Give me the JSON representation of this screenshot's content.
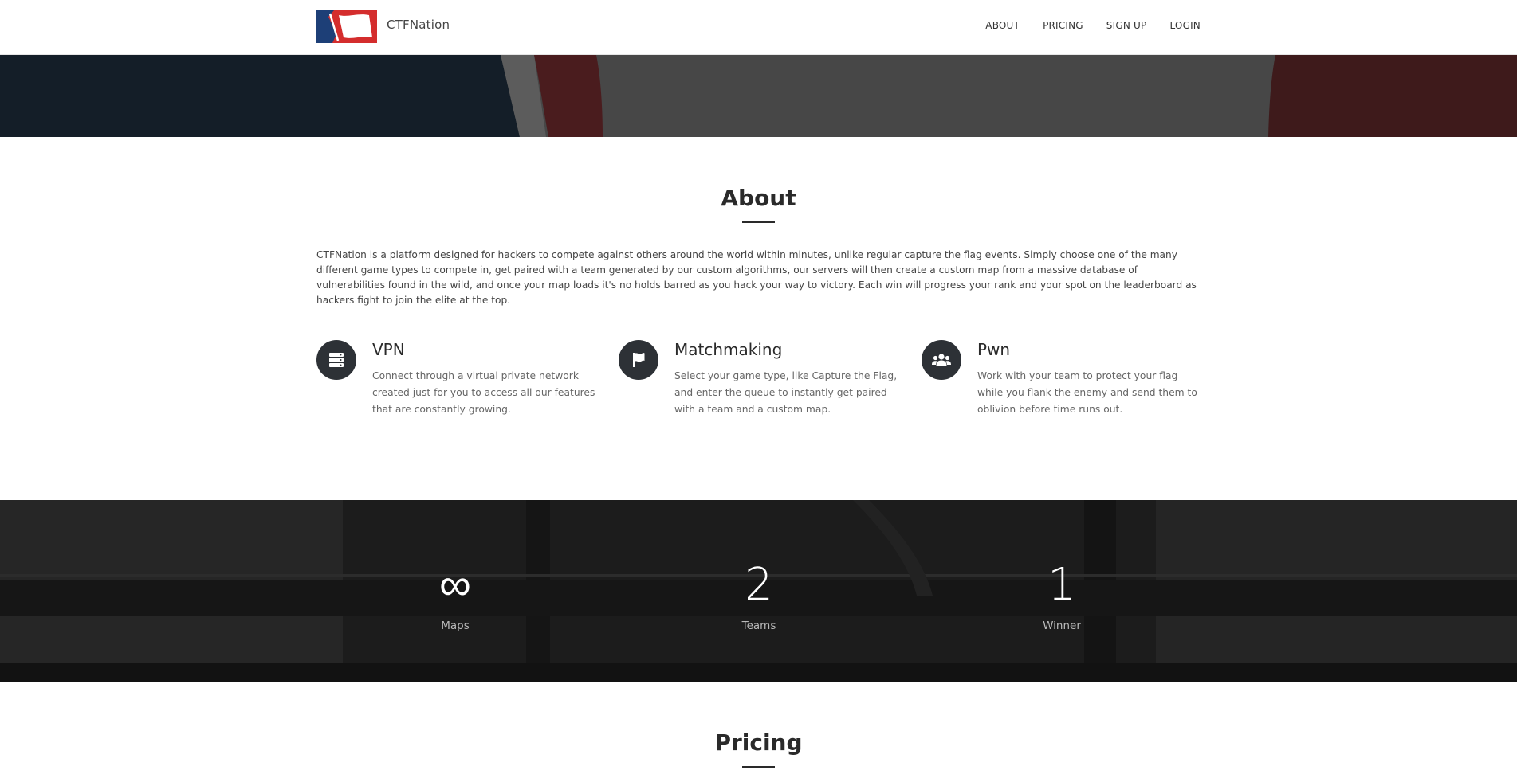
{
  "brand": {
    "name": "CTFNation",
    "colors": {
      "blue": "#1d3f77",
      "red": "#d42d2d",
      "white": "#ffffff"
    }
  },
  "nav": {
    "links": [
      "ABOUT",
      "PRICING",
      "SIGN UP",
      "LOGIN"
    ]
  },
  "about": {
    "title": "About",
    "description": "CTFNation is a platform designed for hackers to compete against others around the world within minutes, unlike regular capture the flag events. Simply choose one of the many different game types to compete in, get paired with a team generated by our custom algorithms, our servers will then create a custom map from a massive database of vulnerabilities found in the wild, and once your map loads it's no holds barred as you hack your way to victory. Each win will progress your rank and your spot on the leaderboard as hackers fight to join the elite at the top.",
    "features": [
      {
        "icon": "server-icon",
        "title": "VPN",
        "text": "Connect through a virtual private network created just for you to access all our features that are constantly growing."
      },
      {
        "icon": "flag-icon",
        "title": "Matchmaking",
        "text": "Select your game type, like Capture the Flag, and enter the queue to instantly get paired with a team and a custom map."
      },
      {
        "icon": "users-icon",
        "title": "Pwn",
        "text": "Work with your team to protect your flag while you flank the enemy and send them to oblivion before time runs out."
      }
    ]
  },
  "stats": [
    {
      "value": "∞",
      "label": "Maps"
    },
    {
      "value": "2",
      "label": "Teams"
    },
    {
      "value": "1",
      "label": "Winner"
    }
  ],
  "pricing": {
    "title": "Pricing"
  }
}
